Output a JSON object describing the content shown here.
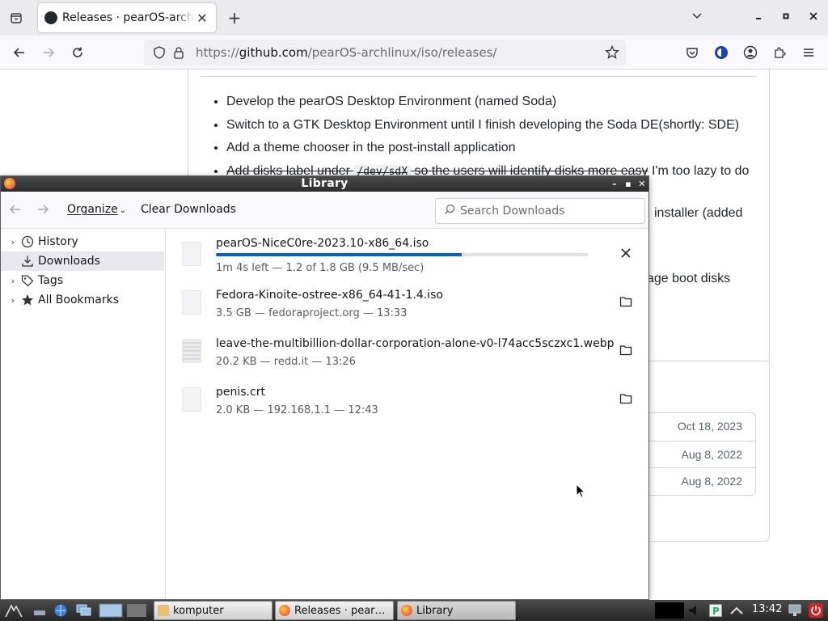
{
  "browser": {
    "tab_title": "Releases · pearOS-archlinux/iso",
    "tab_close": "✕",
    "new_tab": "+",
    "url_scheme_host_prefix": "https://",
    "url_host": "github.com",
    "url_path": "/pearOS-archlinux/iso/releases/"
  },
  "page": {
    "bullets": [
      "Develop the pearOS Desktop Environment (named Soda)",
      "Switch to a GTK Desktop Environment until I finish developing the Soda DE(shortly: SDE)",
      "Add a theme chooser in the post-install application"
    ],
    "strike_pre": "Add disks label under ",
    "strike_code": "/dev/sdX",
    "strike_post": " so the users will identify disks more easy",
    "strike_tail": " I'm too lazy to do",
    "peek_1": "installer (added",
    "peek_2": "age boot disks",
    "dates": [
      "Oct 18, 2023",
      "Aug 8, 2022",
      "Aug 8, 2022"
    ]
  },
  "library": {
    "title": "Library",
    "organize": "Organize",
    "clear_downloads": "Clear Downloads",
    "search_placeholder": "Search Downloads",
    "sidebar": [
      {
        "label": "History"
      },
      {
        "label": "Downloads"
      },
      {
        "label": "Tags"
      },
      {
        "label": "All Bookmarks"
      }
    ],
    "downloads": [
      {
        "name": "pearOS-NiceC0re-2023.10-x86_64.iso",
        "meta": "1m 4s left — 1.2 of 1.8 GB (9.5 MB/sec)",
        "progress": 0.66
      },
      {
        "name": "Fedora-Kinoite-ostree-x86_64-41-1.4.iso",
        "meta": "3.5 GB — fedoraproject.org — 13:33"
      },
      {
        "name": "leave-the-multibillion-dollar-corporation-alone-v0-l74acc5sczxc1.webp",
        "meta": "20.2 KB — redd.it — 13:26"
      },
      {
        "name": "penis.crt",
        "meta": "2.0 KB — 192.168.1.1 — 12:43"
      }
    ]
  },
  "taskbar": {
    "tasks": [
      "komputer",
      "Releases · pear…",
      "Library"
    ],
    "clock": "13:42"
  },
  "colors": {
    "progress_fill": "#0061e0",
    "accent": "#0061e0"
  }
}
